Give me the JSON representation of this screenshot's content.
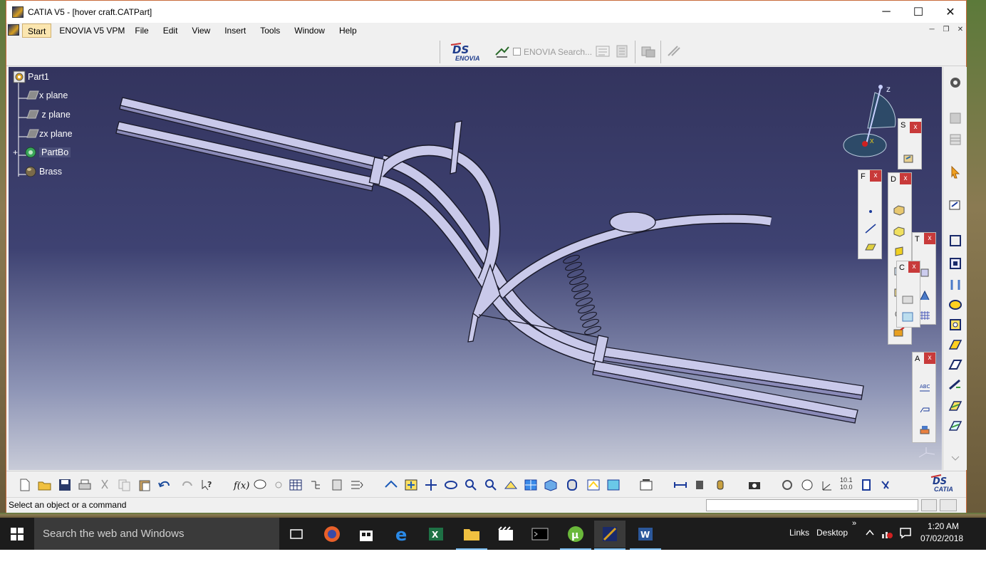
{
  "window": {
    "title": "CATIA V5 - [hover craft.CATPart]",
    "controls": {
      "minimize": "─",
      "maximize": "☐",
      "close": "✕"
    }
  },
  "menubar": {
    "items": [
      {
        "label": "Start",
        "key": "start"
      },
      {
        "label": "ENOVIA V5 VPM",
        "key": "enovia"
      },
      {
        "label": "File",
        "key": "file"
      },
      {
        "label": "Edit",
        "key": "edit"
      },
      {
        "label": "View",
        "key": "view"
      },
      {
        "label": "Insert",
        "key": "insert"
      },
      {
        "label": "Tools",
        "key": "tools"
      },
      {
        "label": "Window",
        "key": "window"
      },
      {
        "label": "Help",
        "key": "help"
      }
    ],
    "mdi_controls": {
      "minimize": "─",
      "restore": "❐",
      "close": "✕"
    }
  },
  "topbar": {
    "enovia_logo_text": "ENOVIA",
    "enovia_search_label": "ENOVIA Search..."
  },
  "tree": {
    "items": [
      {
        "label": "Part1",
        "icon": "part-gear-icon"
      },
      {
        "label": "x   plane",
        "icon": "plane-icon"
      },
      {
        "label": " z plane",
        "icon": "plane-icon"
      },
      {
        "label": "zx plane",
        "icon": "plane-icon"
      },
      {
        "label": "PartBo",
        "icon": "partbody-gear-icon"
      },
      {
        "label": "Brass",
        "icon": "material-sphere-icon"
      }
    ]
  },
  "compass": {
    "z_label": "z",
    "x_label": "x"
  },
  "floating_toolbars": {
    "s": {
      "label": "S",
      "close": "x"
    },
    "f": {
      "label": "F",
      "close": "x"
    },
    "d": {
      "label": "D",
      "close": "x"
    },
    "t": {
      "label": "T",
      "close": "x"
    },
    "c": {
      "label": "C",
      "close": "x"
    },
    "a": {
      "label": "A",
      "close": "x"
    }
  },
  "bottom_toolbar": {
    "catia_logo_text": "CATIA",
    "zoom_label": "10.1 10.0"
  },
  "statusbar": {
    "message": "Select an object or a command"
  },
  "taskbar": {
    "search_placeholder": "Search the web and Windows",
    "links": "Links",
    "desktop": "Desktop",
    "time": "1:20 AM",
    "date": "07/02/2018"
  },
  "colors": {
    "viewport_top": "#33345e",
    "viewport_bottom": "#c8cbd8",
    "part_color": "#c9c9ea",
    "float_close": "#c83a3a",
    "taskbar": "#1c1c1c"
  }
}
